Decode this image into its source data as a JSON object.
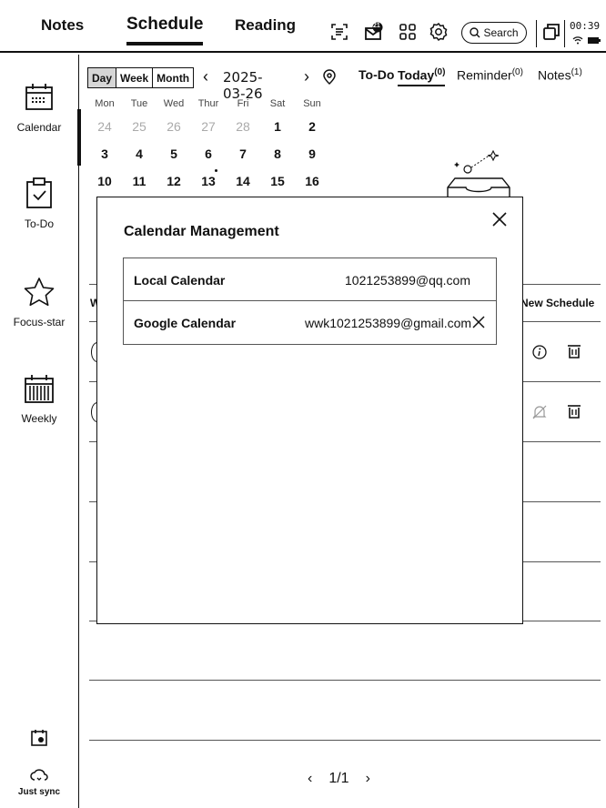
{
  "topbar": {
    "tabs": [
      "Notes",
      "Schedule",
      "Reading"
    ],
    "active_tab": "Schedule",
    "mail_badge": "21",
    "search_label": "Search",
    "clock": "00:39"
  },
  "sidebar": {
    "items": [
      {
        "label": "Calendar",
        "icon": "calendar-icon"
      },
      {
        "label": "To-Do",
        "icon": "clipboard-check-icon"
      },
      {
        "label": "Focus-star",
        "icon": "star-icon"
      },
      {
        "label": "Weekly",
        "icon": "weekly-calendar-icon"
      }
    ],
    "sync_label": "Just sync"
  },
  "calendar": {
    "views": [
      "Day",
      "Week",
      "Month"
    ],
    "active_view": "Day",
    "date": "2025-03-26",
    "weekdays": [
      "Mon",
      "Tue",
      "Wed",
      "Thur",
      "Fri",
      "Sat",
      "Sun"
    ],
    "weeks": [
      [
        "24",
        "25",
        "26",
        "27",
        "28",
        "1",
        "2"
      ],
      [
        "3",
        "4",
        "5",
        "6",
        "7",
        "8",
        "9"
      ],
      [
        "10",
        "11",
        "12",
        "13",
        "14",
        "15",
        "16"
      ]
    ]
  },
  "right_tabs": [
    {
      "label": "To-Do",
      "count": ""
    },
    {
      "label": "Today",
      "count": "(0)"
    },
    {
      "label": "Reminder",
      "count": "(0)"
    },
    {
      "label": "Notes",
      "count": "(1)"
    }
  ],
  "list": {
    "header_left": "W",
    "new_schedule": "New Schedule"
  },
  "modal": {
    "title": "Calendar Management",
    "calendars": [
      {
        "name": "Local Calendar",
        "account": "1021253899@qq.com",
        "removable": false
      },
      {
        "name": "Google Calendar",
        "account": "wwk1021253899@gmail.com",
        "removable": true
      }
    ]
  },
  "pager": {
    "page": "1/1"
  }
}
